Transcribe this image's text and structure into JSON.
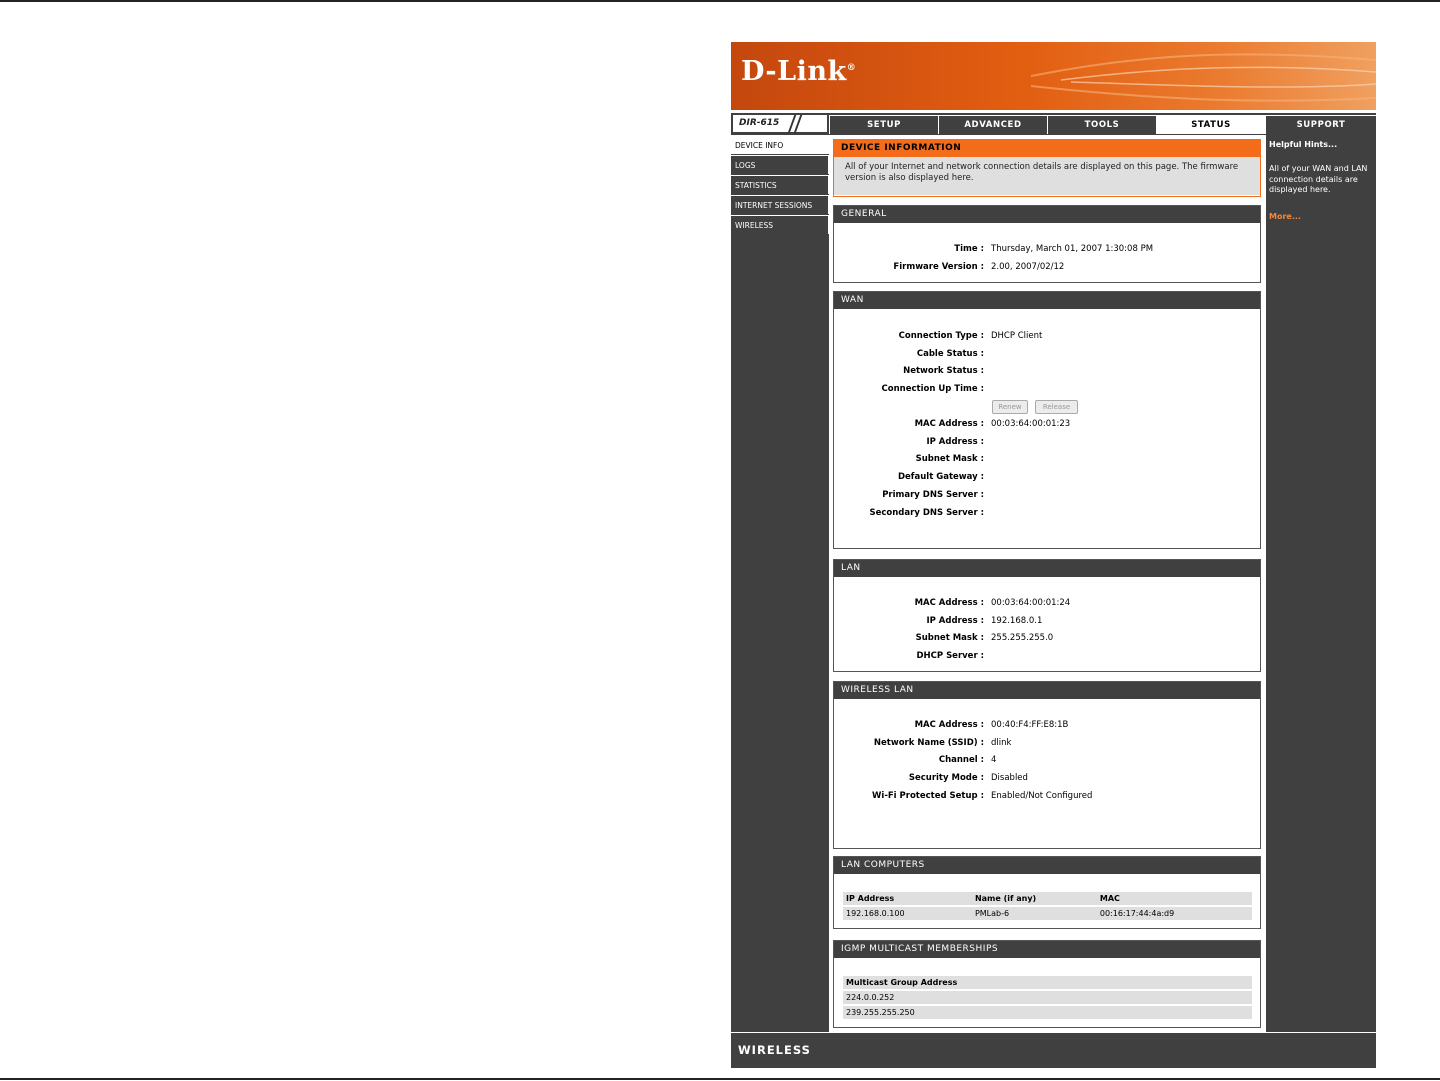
{
  "brand": {
    "logo": "D-Link",
    "model": "DIR-615",
    "footer_label": "WIRELESS"
  },
  "nav": {
    "tabs": [
      {
        "label": "SETUP",
        "active": false
      },
      {
        "label": "ADVANCED",
        "active": false
      },
      {
        "label": "TOOLS",
        "active": false
      },
      {
        "label": "STATUS",
        "active": true
      },
      {
        "label": "SUPPORT",
        "active": false
      }
    ]
  },
  "sidebar": {
    "items": [
      {
        "label": "DEVICE INFO",
        "active": true
      },
      {
        "label": "LOGS",
        "active": false
      },
      {
        "label": "STATISTICS",
        "active": false
      },
      {
        "label": "INTERNET SESSIONS",
        "active": false
      },
      {
        "label": "WIRELESS",
        "active": false
      }
    ]
  },
  "intro": {
    "title": "DEVICE INFORMATION",
    "body": "All of your Internet and network connection details are displayed on this page. The firmware version is also displayed here."
  },
  "general": {
    "title": "GENERAL",
    "rows": [
      {
        "label": "Time :",
        "value": "Thursday, March 01, 2007 1:30:08 PM"
      },
      {
        "label": "Firmware Version :",
        "value": "2.00,  2007/02/12"
      }
    ]
  },
  "wan": {
    "title": "WAN",
    "rows_top": [
      {
        "label": "Connection Type :",
        "value": "DHCP Client"
      },
      {
        "label": "Cable Status :",
        "value": ""
      },
      {
        "label": "Network Status :",
        "value": ""
      },
      {
        "label": "Connection Up Time :",
        "value": ""
      }
    ],
    "renew_label": "Renew",
    "release_label": "Release",
    "rows_bottom": [
      {
        "label": "MAC Address :",
        "value": "00:03:64:00:01:23"
      },
      {
        "label": "IP Address :",
        "value": ""
      },
      {
        "label": "Subnet Mask :",
        "value": ""
      },
      {
        "label": "Default Gateway :",
        "value": ""
      },
      {
        "label": "Primary DNS Server :",
        "value": ""
      },
      {
        "label": "Secondary DNS Server :",
        "value": ""
      }
    ]
  },
  "lan": {
    "title": "LAN",
    "rows": [
      {
        "label": "MAC Address :",
        "value": "00:03:64:00:01:24"
      },
      {
        "label": "IP Address :",
        "value": "192.168.0.1"
      },
      {
        "label": "Subnet Mask :",
        "value": "255.255.255.0"
      },
      {
        "label": "DHCP Server :",
        "value": ""
      }
    ]
  },
  "wlan": {
    "title": "WIRELESS LAN",
    "rows": [
      {
        "label": "MAC Address :",
        "value": "00:40:F4:FF:E8:1B"
      },
      {
        "label": "Network Name (SSID) :",
        "value": "dlink"
      },
      {
        "label": "Channel :",
        "value": "4"
      },
      {
        "label": "Security Mode :",
        "value": "Disabled"
      },
      {
        "label": "Wi-Fi Protected Setup :",
        "value": "Enabled/Not Configured"
      }
    ]
  },
  "lan_computers": {
    "title": "LAN COMPUTERS",
    "headers": [
      "IP Address",
      "Name (if any)",
      "MAC"
    ],
    "rows": [
      [
        "192.168.0.100",
        "PMLab-6",
        "00:16:17:44:4a:d9"
      ]
    ]
  },
  "igmp": {
    "title": "IGMP MULTICAST MEMBERSHIPS",
    "header": "Multicast Group Address",
    "rows": [
      "224.0.0.252",
      "239.255.255.250"
    ]
  },
  "hints": {
    "title": "Helpful Hints...",
    "body": "All of your WAN and LAN connection details are displayed here.",
    "more": "More..."
  }
}
